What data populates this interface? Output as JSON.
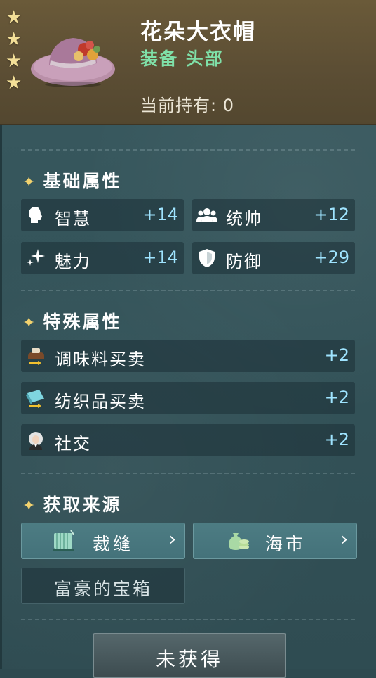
{
  "header": {
    "stars": [
      "★",
      "★",
      "★",
      "★"
    ],
    "item_name": "花朵大衣帽",
    "item_type": "装备 头部",
    "holding_label": "当前持有:",
    "holding_count": "0"
  },
  "base_attributes": {
    "title": "基础属性",
    "stats": [
      {
        "icon": "head-silhouette-icon",
        "label": "智慧",
        "value": "+14"
      },
      {
        "icon": "group-people-icon",
        "label": "统帅",
        "value": "+12"
      },
      {
        "icon": "sparkle-icon",
        "label": "魅力",
        "value": "+14"
      },
      {
        "icon": "shield-icon",
        "label": "防御",
        "value": "+29"
      }
    ]
  },
  "special_attributes": {
    "title": "特殊属性",
    "stats": [
      {
        "icon": "spice-trade-icon",
        "label": "调味料买卖",
        "value": "+2"
      },
      {
        "icon": "textile-trade-icon",
        "label": "纺织品买卖",
        "value": "+2"
      },
      {
        "icon": "social-portrait-icon",
        "label": "社交",
        "value": "+2"
      }
    ]
  },
  "sources": {
    "title": "获取来源",
    "buttons": [
      {
        "icon": "tailoring-icon",
        "label": "裁缝",
        "chevron": "›"
      },
      {
        "icon": "money-bag-icon",
        "label": "海市",
        "chevron": "›"
      }
    ],
    "chest": "富豪的宝箱"
  },
  "status_button": "未获得",
  "colors": {
    "header_bg": "#5c4e34",
    "panel_bg": "#34545a",
    "item_type": "#7fe0a8",
    "stat_value": "#9fe4ff",
    "star": "#f3df97"
  }
}
